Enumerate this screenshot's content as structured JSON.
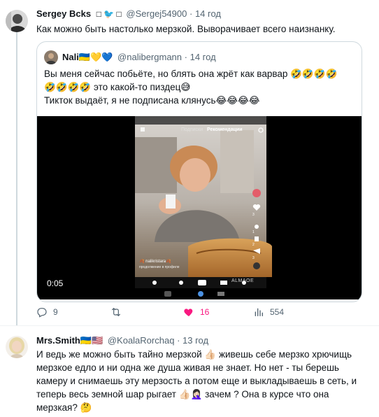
{
  "tweet1": {
    "author_name": "Sergey Bcks",
    "author_icons": "□ 🐦 □",
    "handle": "@Sergej54900",
    "separator": "·",
    "time": "14 год",
    "text": "Как можно быть настолько мерзкой. Выворачивает всего наизнанку.",
    "actions": {
      "replies": "9",
      "retweets": "",
      "likes": "16",
      "views": "554"
    },
    "quoted": {
      "author_name": "Nali",
      "author_emojis": "🇺🇦💛💙",
      "handle": "@nalibergmann",
      "time": "14 год",
      "line1": "Вы меня сейчас побьёте, но блять она жрёт как варвар 🤣🤣🤣🤣",
      "line2": "🤣🤣🤣🤣 это какой-то пиздец😅",
      "line3": "Тикток выдаёт, я не подписана клянусь😂😂😂😂",
      "video": {
        "duration": "0:05",
        "app_tab_inactive": "Подписки",
        "app_tab_active": "Рекомендации",
        "caption_user": "🍂 nalikristara🍂",
        "caption_text": "прoдолжение в профиле",
        "side_counts": [
          "3",
          "1",
          "2",
          "3"
        ],
        "watermark": "ALMAOE"
      }
    }
  },
  "tweet2": {
    "author_name": "Mrs.Smith",
    "author_emojis": "🇺🇦🇺🇸",
    "handle": "@KoalaRorchaq",
    "separator": "·",
    "time": "13 год",
    "line1": "И ведь же можно быть тайно мерзкой 👍🏻 живешь себе мерзко хрючищь",
    "line2": "мерзкое едло и ни одна же душа живая не знает. Но нет - ты берешь",
    "line3": "камеру и снимаешь эту мерзость а потом еще и выкладываешь в сеть, и",
    "line4": "теперь весь земной шар рыгает 👍🏻🤦🏻‍♀️ зачем ? Она в курсе что она",
    "line5": "мерзкая? 🤔"
  },
  "colors": {
    "like_pink": "#f91880",
    "secondary_text": "#536471",
    "border": "#cfd9de"
  },
  "icons": [
    "reply-icon",
    "retweet-icon",
    "like-icon",
    "views-icon"
  ]
}
